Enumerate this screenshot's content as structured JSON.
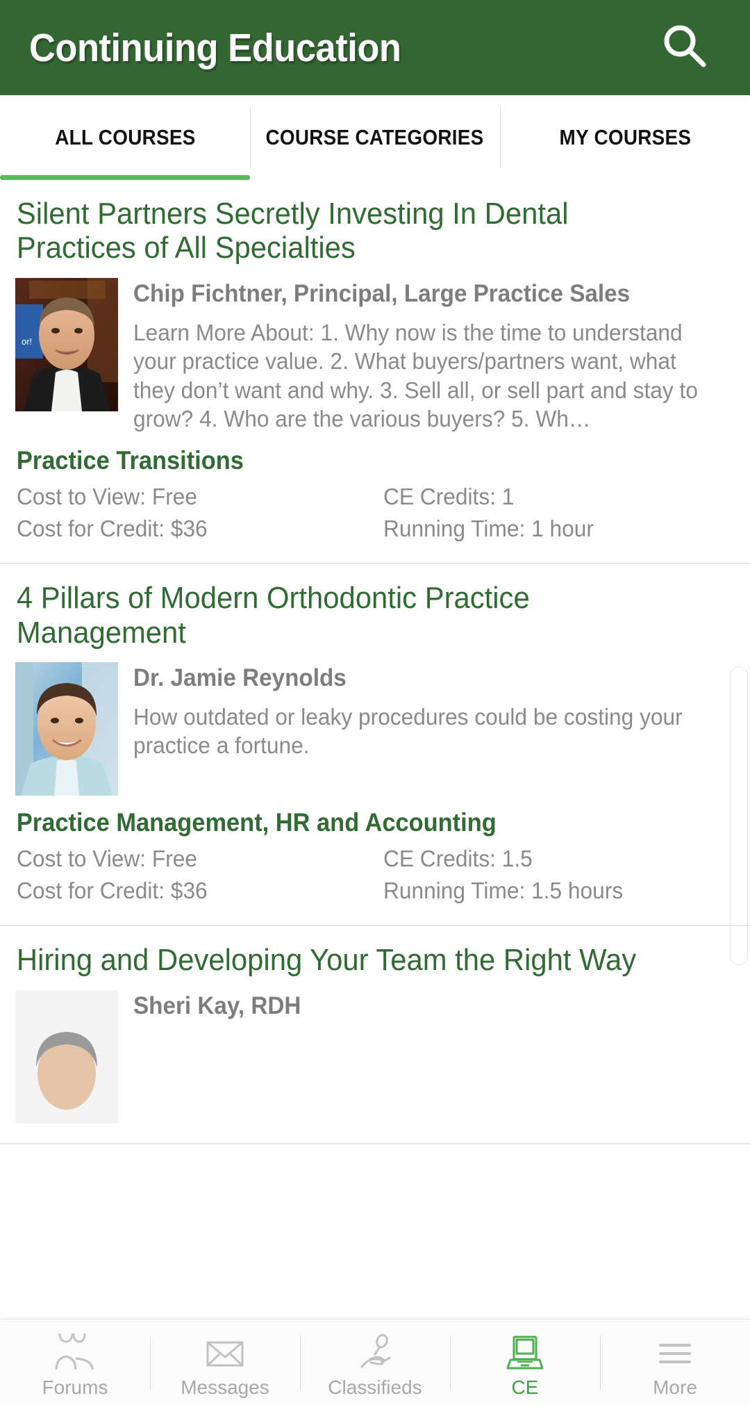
{
  "header": {
    "title": "Continuing Education",
    "search_icon": "search-icon",
    "bg_color": "#336633"
  },
  "tabs": [
    {
      "label": "ALL COURSES",
      "active": true
    },
    {
      "label": "COURSE CATEGORIES",
      "active": false
    },
    {
      "label": "MY COURSES",
      "active": false
    }
  ],
  "courses": [
    {
      "title": "Silent Partners Secretly Investing In Dental Practices of All Specialties",
      "speaker": "Chip Fichtner, Principal, Large Practice Sales",
      "description": "Learn More About: 1. Why now is the time to understand your practice value. 2. What buyers/partners want, what they don’t want and why. 3. Sell all, or sell part and stay to grow? 4. Who are the various buyers? 5. Wh…",
      "category": "Practice Transitions",
      "cost_to_view": "Cost to View: Free",
      "ce_credits": "CE Credits: 1",
      "cost_for_credit": "Cost for Credit: $36",
      "running_time": "Running Time: 1 hour",
      "thumbnail": "speaker-portrait-chip-fichtner"
    },
    {
      "title": "4 Pillars of Modern Orthodontic Practice Management",
      "speaker": "Dr. Jamie Reynolds",
      "description": "How outdated or leaky procedures could be costing your practice a fortune.",
      "category": "Practice Management, HR and Accounting",
      "cost_to_view": "Cost to View: Free",
      "ce_credits": "CE Credits: 1.5",
      "cost_for_credit": "Cost for Credit: $36",
      "running_time": "Running Time: 1.5 hours",
      "thumbnail": "speaker-portrait-jamie-reynolds"
    },
    {
      "title": "Hiring and Developing Your Team the Right Way",
      "speaker": "Sheri Kay, RDH",
      "description": "",
      "category": "",
      "cost_to_view": "",
      "ce_credits": "",
      "cost_for_credit": "",
      "running_time": "",
      "thumbnail": "speaker-portrait-sheri-kay"
    }
  ],
  "bottom_nav": [
    {
      "label": "Forums",
      "icon": "people-icon",
      "active": false
    },
    {
      "label": "Messages",
      "icon": "envelope-icon",
      "active": false
    },
    {
      "label": "Classifieds",
      "icon": "hand-money-icon",
      "active": false
    },
    {
      "label": "CE",
      "icon": "laptop-icon",
      "active": true
    },
    {
      "label": "More",
      "icon": "hamburger-icon",
      "active": false
    }
  ],
  "colors": {
    "brand_green": "#336633",
    "accent_green": "#5cb85c",
    "title_green": "#2f6b33",
    "muted_gray": "#8a8a8a"
  },
  "scrollbar": {
    "visible": true
  }
}
